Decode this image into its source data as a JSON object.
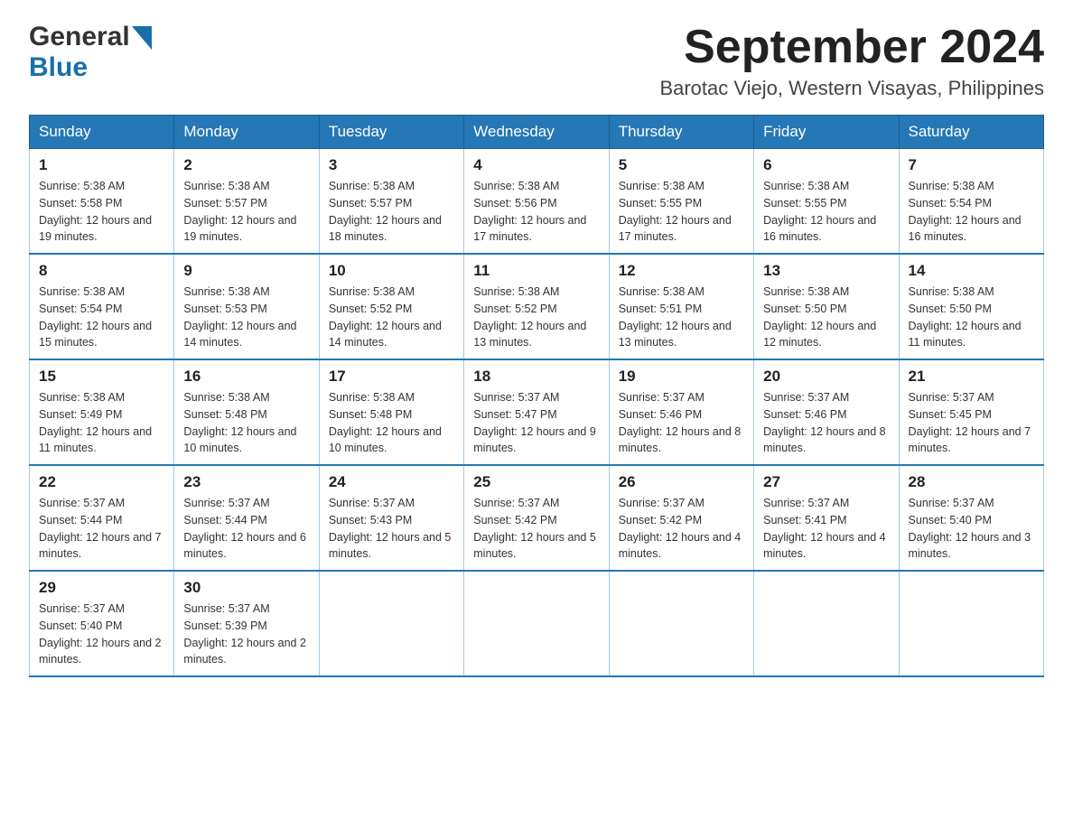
{
  "header": {
    "logo_general": "General",
    "logo_blue": "Blue",
    "month_title": "September 2024",
    "location": "Barotac Viejo, Western Visayas, Philippines"
  },
  "days_of_week": [
    "Sunday",
    "Monday",
    "Tuesday",
    "Wednesday",
    "Thursday",
    "Friday",
    "Saturday"
  ],
  "weeks": [
    [
      {
        "day": "1",
        "sunrise": "Sunrise: 5:38 AM",
        "sunset": "Sunset: 5:58 PM",
        "daylight": "Daylight: 12 hours and 19 minutes."
      },
      {
        "day": "2",
        "sunrise": "Sunrise: 5:38 AM",
        "sunset": "Sunset: 5:57 PM",
        "daylight": "Daylight: 12 hours and 19 minutes."
      },
      {
        "day": "3",
        "sunrise": "Sunrise: 5:38 AM",
        "sunset": "Sunset: 5:57 PM",
        "daylight": "Daylight: 12 hours and 18 minutes."
      },
      {
        "day": "4",
        "sunrise": "Sunrise: 5:38 AM",
        "sunset": "Sunset: 5:56 PM",
        "daylight": "Daylight: 12 hours and 17 minutes."
      },
      {
        "day": "5",
        "sunrise": "Sunrise: 5:38 AM",
        "sunset": "Sunset: 5:55 PM",
        "daylight": "Daylight: 12 hours and 17 minutes."
      },
      {
        "day": "6",
        "sunrise": "Sunrise: 5:38 AM",
        "sunset": "Sunset: 5:55 PM",
        "daylight": "Daylight: 12 hours and 16 minutes."
      },
      {
        "day": "7",
        "sunrise": "Sunrise: 5:38 AM",
        "sunset": "Sunset: 5:54 PM",
        "daylight": "Daylight: 12 hours and 16 minutes."
      }
    ],
    [
      {
        "day": "8",
        "sunrise": "Sunrise: 5:38 AM",
        "sunset": "Sunset: 5:54 PM",
        "daylight": "Daylight: 12 hours and 15 minutes."
      },
      {
        "day": "9",
        "sunrise": "Sunrise: 5:38 AM",
        "sunset": "Sunset: 5:53 PM",
        "daylight": "Daylight: 12 hours and 14 minutes."
      },
      {
        "day": "10",
        "sunrise": "Sunrise: 5:38 AM",
        "sunset": "Sunset: 5:52 PM",
        "daylight": "Daylight: 12 hours and 14 minutes."
      },
      {
        "day": "11",
        "sunrise": "Sunrise: 5:38 AM",
        "sunset": "Sunset: 5:52 PM",
        "daylight": "Daylight: 12 hours and 13 minutes."
      },
      {
        "day": "12",
        "sunrise": "Sunrise: 5:38 AM",
        "sunset": "Sunset: 5:51 PM",
        "daylight": "Daylight: 12 hours and 13 minutes."
      },
      {
        "day": "13",
        "sunrise": "Sunrise: 5:38 AM",
        "sunset": "Sunset: 5:50 PM",
        "daylight": "Daylight: 12 hours and 12 minutes."
      },
      {
        "day": "14",
        "sunrise": "Sunrise: 5:38 AM",
        "sunset": "Sunset: 5:50 PM",
        "daylight": "Daylight: 12 hours and 11 minutes."
      }
    ],
    [
      {
        "day": "15",
        "sunrise": "Sunrise: 5:38 AM",
        "sunset": "Sunset: 5:49 PM",
        "daylight": "Daylight: 12 hours and 11 minutes."
      },
      {
        "day": "16",
        "sunrise": "Sunrise: 5:38 AM",
        "sunset": "Sunset: 5:48 PM",
        "daylight": "Daylight: 12 hours and 10 minutes."
      },
      {
        "day": "17",
        "sunrise": "Sunrise: 5:38 AM",
        "sunset": "Sunset: 5:48 PM",
        "daylight": "Daylight: 12 hours and 10 minutes."
      },
      {
        "day": "18",
        "sunrise": "Sunrise: 5:37 AM",
        "sunset": "Sunset: 5:47 PM",
        "daylight": "Daylight: 12 hours and 9 minutes."
      },
      {
        "day": "19",
        "sunrise": "Sunrise: 5:37 AM",
        "sunset": "Sunset: 5:46 PM",
        "daylight": "Daylight: 12 hours and 8 minutes."
      },
      {
        "day": "20",
        "sunrise": "Sunrise: 5:37 AM",
        "sunset": "Sunset: 5:46 PM",
        "daylight": "Daylight: 12 hours and 8 minutes."
      },
      {
        "day": "21",
        "sunrise": "Sunrise: 5:37 AM",
        "sunset": "Sunset: 5:45 PM",
        "daylight": "Daylight: 12 hours and 7 minutes."
      }
    ],
    [
      {
        "day": "22",
        "sunrise": "Sunrise: 5:37 AM",
        "sunset": "Sunset: 5:44 PM",
        "daylight": "Daylight: 12 hours and 7 minutes."
      },
      {
        "day": "23",
        "sunrise": "Sunrise: 5:37 AM",
        "sunset": "Sunset: 5:44 PM",
        "daylight": "Daylight: 12 hours and 6 minutes."
      },
      {
        "day": "24",
        "sunrise": "Sunrise: 5:37 AM",
        "sunset": "Sunset: 5:43 PM",
        "daylight": "Daylight: 12 hours and 5 minutes."
      },
      {
        "day": "25",
        "sunrise": "Sunrise: 5:37 AM",
        "sunset": "Sunset: 5:42 PM",
        "daylight": "Daylight: 12 hours and 5 minutes."
      },
      {
        "day": "26",
        "sunrise": "Sunrise: 5:37 AM",
        "sunset": "Sunset: 5:42 PM",
        "daylight": "Daylight: 12 hours and 4 minutes."
      },
      {
        "day": "27",
        "sunrise": "Sunrise: 5:37 AM",
        "sunset": "Sunset: 5:41 PM",
        "daylight": "Daylight: 12 hours and 4 minutes."
      },
      {
        "day": "28",
        "sunrise": "Sunrise: 5:37 AM",
        "sunset": "Sunset: 5:40 PM",
        "daylight": "Daylight: 12 hours and 3 minutes."
      }
    ],
    [
      {
        "day": "29",
        "sunrise": "Sunrise: 5:37 AM",
        "sunset": "Sunset: 5:40 PM",
        "daylight": "Daylight: 12 hours and 2 minutes."
      },
      {
        "day": "30",
        "sunrise": "Sunrise: 5:37 AM",
        "sunset": "Sunset: 5:39 PM",
        "daylight": "Daylight: 12 hours and 2 minutes."
      },
      null,
      null,
      null,
      null,
      null
    ]
  ]
}
